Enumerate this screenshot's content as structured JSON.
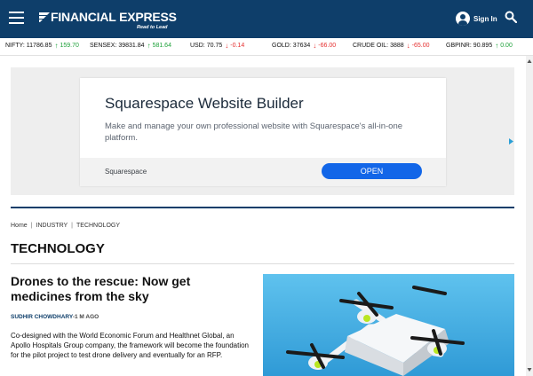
{
  "header": {
    "brand": "FINANCIAL EXPRESS",
    "tagline": "Read to Lead",
    "signin_label": "Sign In",
    "background": "#0e3e6a"
  },
  "ticker": [
    {
      "name": "NIFTY:",
      "value": "11786.85",
      "change": "159.70",
      "direction": "up"
    },
    {
      "name": "SENSEX:",
      "value": "39831.84",
      "change": "581.64",
      "direction": "up"
    },
    {
      "name": "USD:",
      "value": "70.75",
      "change": "-0.14",
      "direction": "down"
    },
    {
      "name": "GOLD:",
      "value": "37634",
      "change": "-66.00",
      "direction": "down"
    },
    {
      "name": "CRUDE OIL:",
      "value": "3888",
      "change": "-65.00",
      "direction": "down"
    },
    {
      "name": "GBPINR:",
      "value": "90.895",
      "change": "0.00",
      "direction": "up"
    }
  ],
  "colors": {
    "up": "#1ea13a",
    "down": "#e53030",
    "accent": "#1266e8"
  },
  "ad": {
    "title": "Squarespace Website Builder",
    "description": "Make and manage your own professional website with Squarespace's all-in-one platform.",
    "brand": "Squarespace",
    "cta": "OPEN"
  },
  "breadcrumb": [
    "Home",
    "INDUSTRY",
    "TECHNOLOGY"
  ],
  "page_title": "TECHNOLOGY",
  "article": {
    "headline": "Drones to the rescue: Now get medicines from the sky",
    "author": "SUDHIR CHOWDHARY",
    "time_ago": "1 M AGO",
    "summary": "Co-designed with the World Economic Forum and Healthnet Global, an Apollo Hospitals Group company, the framework will become the foundation for the pilot project to test drone delivery and eventually for an RFP."
  }
}
